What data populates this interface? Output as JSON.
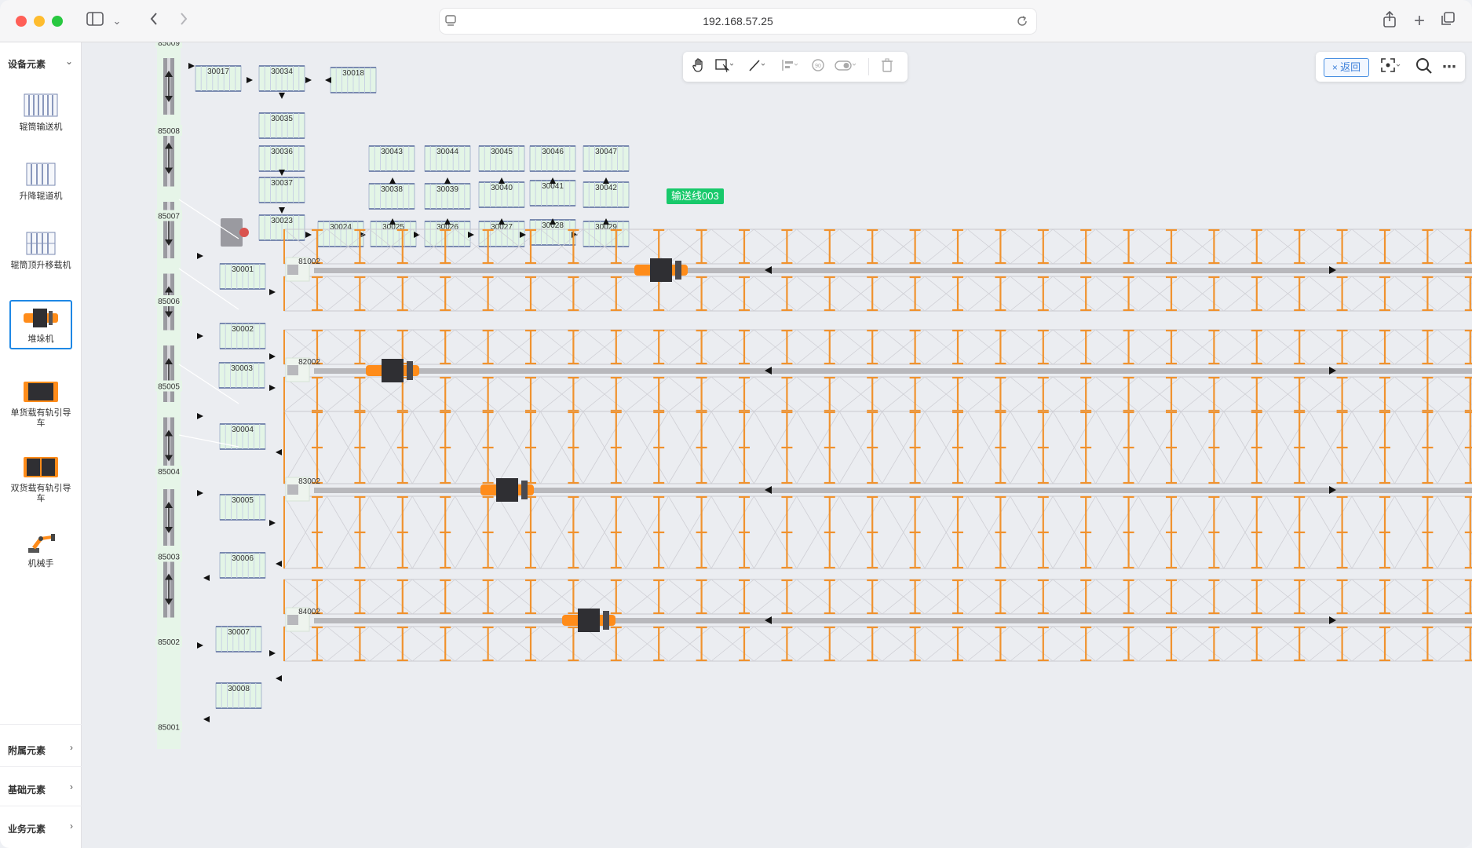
{
  "browser": {
    "address": "192.168.57.25",
    "traffic_colors": [
      "#ff5f57",
      "#febc2e",
      "#28c840"
    ]
  },
  "sidebar": {
    "sections": {
      "device": "设备元素",
      "attached": "附属元素",
      "basic": "基础元素",
      "business": "业务元素"
    },
    "items": [
      {
        "label": "辊筒输送机",
        "icon": "roller-conveyor-icon"
      },
      {
        "label": "升降辊道机",
        "icon": "lift-roller-icon"
      },
      {
        "label": "辊筒顶升移载机",
        "icon": "roller-transfer-icon"
      },
      {
        "label": "堆垛机",
        "icon": "stacker-icon",
        "selected": true
      },
      {
        "label": "单货载有轨引导车",
        "icon": "single-rgv-icon"
      },
      {
        "label": "双货载有轨引导车",
        "icon": "double-rgv-icon"
      },
      {
        "label": "机械手",
        "icon": "robot-arm-icon"
      }
    ]
  },
  "toolbar": {
    "tools": [
      "hand-icon",
      "select-icon",
      "line-icon",
      "align-icon",
      "rotate-icon",
      "toggle-icon",
      "trash-icon"
    ]
  },
  "right_tools": {
    "back_label": "返回"
  },
  "canvas": {
    "tag_label": "输送线003",
    "lift_labels": [
      "85009",
      "85008",
      "85007",
      "85006",
      "85005",
      "85004",
      "85003",
      "85002",
      "85001"
    ],
    "top_conveyors": [
      "30017",
      "30034",
      "30018",
      "30035",
      "30036",
      "30037",
      "30023",
      "30024",
      "30025",
      "30026",
      "30027",
      "30028",
      "30029",
      "30038",
      "30039",
      "30040",
      "30041",
      "30042",
      "30043",
      "30044",
      "30045",
      "30046",
      "30047"
    ],
    "side_conveyors": [
      "30001",
      "30002",
      "30003",
      "30004",
      "30005",
      "30006",
      "30007",
      "30008"
    ],
    "aisles": [
      {
        "label": "81002"
      },
      {
        "label": "82002"
      },
      {
        "label": "83002"
      },
      {
        "label": "84002"
      }
    ],
    "colors": {
      "rack": "#f0922e",
      "rail": "#b8b8bc",
      "conveyor_fill": "#e3f5e6",
      "conveyor_edge": "#7a8ab0",
      "lift_fill": "#e6f5e8",
      "stacker_body": "#2f2f33",
      "stacker_accent": "#ff8c1a"
    }
  }
}
